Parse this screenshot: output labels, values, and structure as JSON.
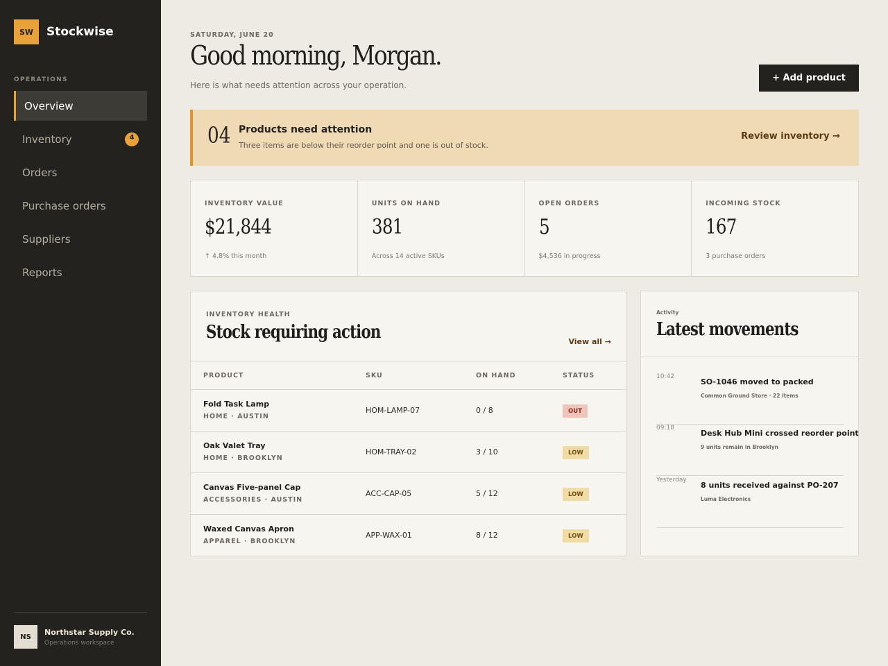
{
  "brand": {
    "logo": "SW",
    "name": "Stockwise"
  },
  "sidebar": {
    "section_label": "OPERATIONS",
    "items": [
      {
        "label": "Overview",
        "active": true
      },
      {
        "label": "Inventory",
        "badge": "4"
      },
      {
        "label": "Orders"
      },
      {
        "label": "Purchase orders"
      },
      {
        "label": "Suppliers"
      },
      {
        "label": "Reports"
      }
    ],
    "org": {
      "avatar": "NS",
      "name": "Northstar Supply Co.",
      "sub": "Operations workspace"
    }
  },
  "header": {
    "date": "SATURDAY, JUNE 20",
    "greeting": "Good morning, Morgan.",
    "subtitle": "Here is what needs attention across your operation.",
    "add_button": "+ Add product"
  },
  "alert": {
    "count": "04",
    "title": "Products need attention",
    "description": "Three items are below their reorder point and one is out of stock.",
    "link": "Review inventory →"
  },
  "stats": [
    {
      "label": "INVENTORY VALUE",
      "value": "$21,844",
      "sub": "↑ 4.8% this month"
    },
    {
      "label": "UNITS ON HAND",
      "value": "381",
      "sub": "Across 14 active SKUs"
    },
    {
      "label": "OPEN ORDERS",
      "value": "5",
      "sub": "$4,536 in progress"
    },
    {
      "label": "INCOMING STOCK",
      "value": "167",
      "sub": "3 purchase orders"
    }
  ],
  "health": {
    "eyebrow": "INVENTORY HEALTH",
    "title": "Stock requiring action",
    "view_all": "View all →",
    "columns": [
      "PRODUCT",
      "SKU",
      "ON HAND",
      "STATUS"
    ],
    "rows": [
      {
        "name": "Fold Task Lamp",
        "meta": "HOME · AUSTIN",
        "sku": "HOM-LAMP-07",
        "on_hand": "0 / 8",
        "status": "OUT"
      },
      {
        "name": "Oak Valet Tray",
        "meta": "HOME · BROOKLYN",
        "sku": "HOM-TRAY-02",
        "on_hand": "3 / 10",
        "status": "LOW"
      },
      {
        "name": "Canvas Five-panel Cap",
        "meta": "ACCESSORIES · AUSTIN",
        "sku": "ACC-CAP-05",
        "on_hand": "5 / 12",
        "status": "LOW"
      },
      {
        "name": "Waxed Canvas Apron",
        "meta": "APPAREL · BROOKLYN",
        "sku": "APP-WAX-01",
        "on_hand": "8 / 12",
        "status": "LOW"
      }
    ]
  },
  "activity": {
    "eyebrow": "Activity",
    "title": "Latest movements",
    "items": [
      {
        "time": "10:42",
        "text": "SO-1046 moved to packed",
        "sub": "Common Ground Store · 22 items"
      },
      {
        "time": "09:18",
        "text": "Desk Hub Mini crossed reorder point",
        "sub": "9 units remain in Brooklyn"
      },
      {
        "time": "Yesterday",
        "text": "8 units received against PO-207",
        "sub": "Luma Electronics"
      }
    ]
  },
  "colors": {
    "sidebar_bg": "#23221f",
    "accent": "#e8a23a",
    "page_bg": "#eeebe5",
    "alert_bg": "#f0d9b5",
    "status_out": "#efc4bb",
    "status_low": "#f2dca6"
  }
}
